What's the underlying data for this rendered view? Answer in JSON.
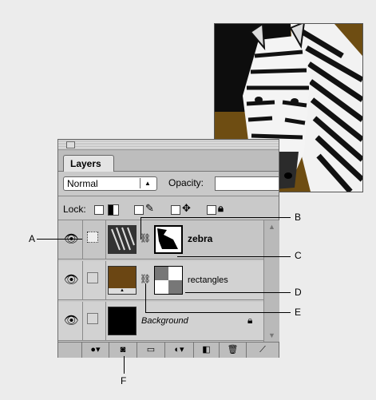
{
  "palette": {
    "tab_label": "Layers",
    "blend_mode": "Normal",
    "opacity_label": "Opacity:",
    "lock_label": "Lock:",
    "layers": [
      {
        "name": "zebra",
        "visible": true,
        "selected": true
      },
      {
        "name": "rectangles",
        "visible": true,
        "selected": false
      },
      {
        "name": "Background",
        "visible": true,
        "selected": false
      }
    ],
    "icons": {
      "eye": "eye-icon",
      "link": "link-chain-icon",
      "lock": "lock-icon",
      "bottom": [
        "layer-style-icon",
        "add-mask-icon",
        "new-set-icon",
        "adjustment-layer-icon",
        "new-layer-icon",
        "trash-icon"
      ]
    }
  },
  "callouts": {
    "a": "A",
    "b": "B",
    "c": "C",
    "d": "D",
    "e": "E",
    "f": "F"
  }
}
